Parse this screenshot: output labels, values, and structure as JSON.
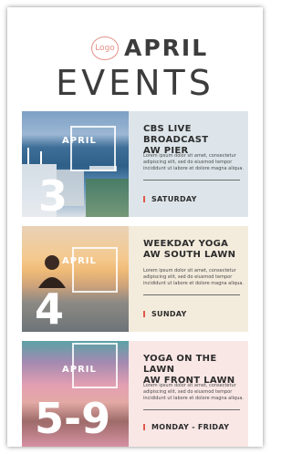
{
  "header": {
    "logo": "Logo",
    "title": "APRIL",
    "subtitle": "EVENTS"
  },
  "events": [
    {
      "month": "APRIL",
      "day": "3",
      "title_line1": "CBS LIVE BROADCAST",
      "title_line2": "AW PIER",
      "description": "Lorem ipsum dolor sit amet, consectetur adipiscing elit, sed do eiusmod tempor incididunt ut labore et dolore magna aliqua.",
      "when": "SATURDAY",
      "info_bg": "#dde5ea"
    },
    {
      "month": "APRIL",
      "day": "4",
      "title_line1": "WEEKDAY YOGA",
      "title_line2": "AW SOUTH LAWN",
      "description": "Lorem ipsum dolor sit amet, consectetur adipiscing elit, sed do eiusmod tempor incididunt ut labore et dolore magna aliqua.",
      "when": "SUNDAY",
      "info_bg": "#f3ebdc"
    },
    {
      "month": "APRIL",
      "day": "5-9",
      "title_line1": "YOGA ON THE LAWN",
      "title_line2": "AW FRONT LAWN",
      "description": "Lorem ipsum dolor sit amet, consectetur adipiscing elit, sed do eiusmod tempor incididunt ut labore et dolore magna aliqua.",
      "when": "MONDAY - FRIDAY",
      "info_bg": "#f9e7e6"
    }
  ]
}
